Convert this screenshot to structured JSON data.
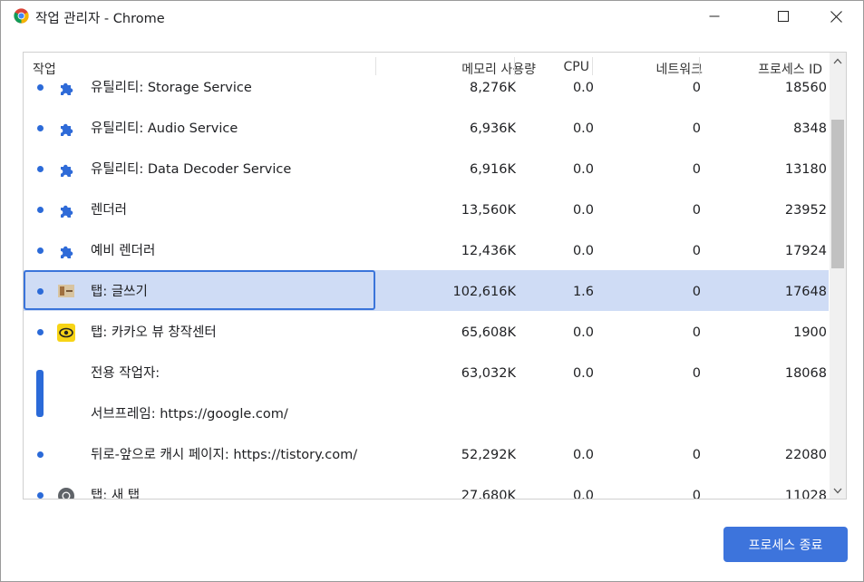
{
  "window": {
    "title": "작업 관리자 - Chrome"
  },
  "columns": {
    "task": "작업",
    "memory": "메모리 사용량",
    "cpu": "CPU",
    "network": "네트워크",
    "pid": "프로세스 ID"
  },
  "rows": [
    {
      "name": "유틸리티: Storage Service",
      "icon": "extension-puzzle-icon",
      "memory": "8,276K",
      "cpu": "0.0",
      "network": "0",
      "pid": "18560"
    },
    {
      "name": "유틸리티: Audio Service",
      "icon": "extension-puzzle-icon",
      "memory": "6,936K",
      "cpu": "0.0",
      "network": "0",
      "pid": "8348"
    },
    {
      "name": "유틸리티: Data Decoder Service",
      "icon": "extension-puzzle-icon",
      "memory": "6,916K",
      "cpu": "0.0",
      "network": "0",
      "pid": "13180"
    },
    {
      "name": "렌더러",
      "icon": "extension-puzzle-icon",
      "memory": "13,560K",
      "cpu": "0.0",
      "network": "0",
      "pid": "23952"
    },
    {
      "name": "예비 렌더러",
      "icon": "extension-puzzle-icon",
      "memory": "12,436K",
      "cpu": "0.0",
      "network": "0",
      "pid": "17924"
    },
    {
      "name": "탭: 글쓰기",
      "icon": "tistory-tab-icon",
      "memory": "102,616K",
      "cpu": "1.6",
      "network": "0",
      "pid": "17648",
      "selected": true
    },
    {
      "name": "탭: 카카오 뷰 창작센터",
      "icon": "kakao-view-icon",
      "memory": "65,608K",
      "cpu": "0.0",
      "network": "0",
      "pid": "1900"
    },
    {
      "name": "전용 작업자:",
      "icon": "",
      "memory": "63,032K",
      "cpu": "0.0",
      "network": "0",
      "pid": "18068"
    },
    {
      "name": "서브프레임: https://google.com/",
      "icon": "",
      "memory": "",
      "cpu": "",
      "network": "",
      "pid": ""
    },
    {
      "name": "뒤로-앞으로 캐시 페이지: https://tistory.com/",
      "icon": "",
      "memory": "52,292K",
      "cpu": "0.0",
      "network": "0",
      "pid": "22080"
    },
    {
      "name": "탭: 새 탭",
      "icon": "chrome-tab-icon",
      "memory": "27,680K",
      "cpu": "0.0",
      "network": "0",
      "pid": "11028"
    }
  ],
  "end_process_button": "프로세스 종료",
  "colors": {
    "accent": "#3d74dc",
    "selected_row": "#cfdcf5",
    "dot": "#2b6ad8",
    "puzzle": "#2f6bd8"
  }
}
